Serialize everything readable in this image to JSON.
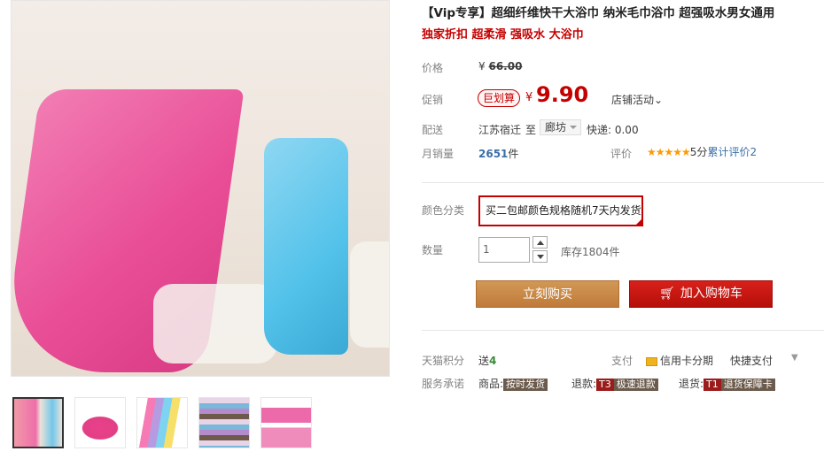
{
  "title": "【Vip专享】超细纤维快干大浴巾 纳米毛巾浴巾 超强吸水男女通用",
  "subtitle": "独家折扣 超柔滑 强吸水 大浴巾",
  "price": {
    "label": "价格",
    "currency": "¥",
    "value": "66.00"
  },
  "promo": {
    "label": "促销",
    "badge": "巨划算",
    "currency": "¥",
    "value": "9.90",
    "shop_event": "店铺活动"
  },
  "shipping": {
    "label": "配送",
    "from": "江苏宿迁",
    "to_word": "至",
    "to": "廊坊",
    "fee": "快递: 0.00"
  },
  "sales": {
    "label": "月销量",
    "count": "2651",
    "unit": "件",
    "review_label": "评价",
    "stars": "★★★★★",
    "score": "5分",
    "review_count": "累计评价2"
  },
  "color": {
    "label": "颜色分类",
    "option": "买二包邮颜色规格随机7天内发货"
  },
  "quantity": {
    "label": "数量",
    "value": "1",
    "stock": "库存1804件"
  },
  "buttons": {
    "buy_now": "立刻购买",
    "add_cart": "加入购物车"
  },
  "points": {
    "label": "天猫积分",
    "text": "送",
    "value": "4",
    "pay_label": "支付",
    "credit": "信用卡分期",
    "quick": "快捷支付"
  },
  "service": {
    "label": "服务承诺",
    "goods": "商品:",
    "goods_badge": "按时发货",
    "refund": "退款:",
    "refund_code": "T3",
    "refund_badge": "极速退款",
    "return": "退货:",
    "return_code": "T1",
    "return_badge": "退货保障卡"
  },
  "colors": {
    "accent": "#c40000",
    "buy": "#c98b4b",
    "link": "#3a6fa8"
  }
}
